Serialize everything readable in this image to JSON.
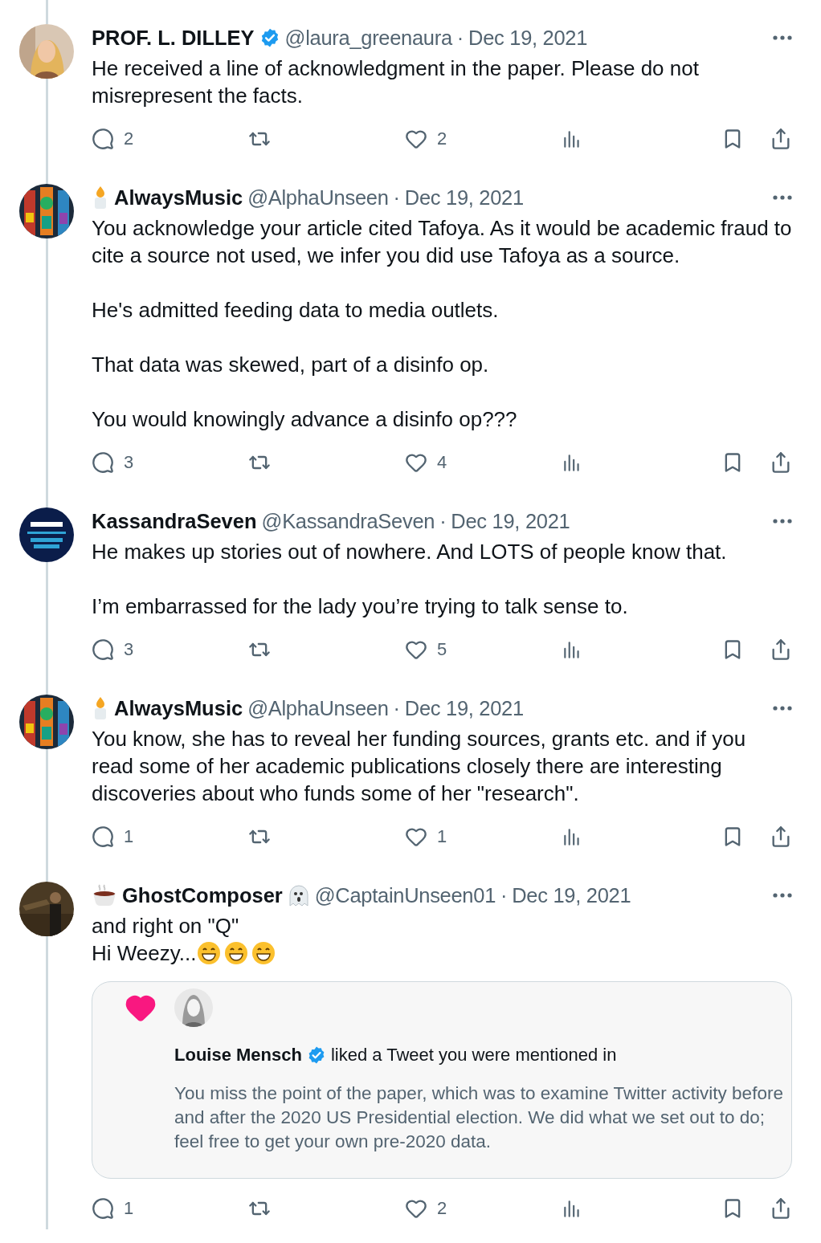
{
  "tweets": [
    {
      "avatar": {
        "kind": "person"
      },
      "author": {
        "name": "PROF. L. DILLEY",
        "verified": true,
        "handle": "@laura_greenaura",
        "separator": "·",
        "date": "Dec 19, 2021"
      },
      "paragraphs": [
        {
          "lines": [
            {
              "text": "He received a line of acknowledgment in the paper. Please do not misrepresent the facts."
            }
          ]
        }
      ],
      "stats": {
        "replies": "2",
        "likes": "2"
      }
    },
    {
      "avatar": {
        "kind": "stained-glass"
      },
      "author": {
        "emoji_before": {
          "kind": "candle"
        },
        "name": "AlwaysMusic",
        "verified": false,
        "handle": "@AlphaUnseen",
        "separator": "·",
        "date": "Dec 19, 2021"
      },
      "paragraphs": [
        {
          "lines": [
            {
              "text": "You acknowledge your article cited Tafoya. As it would be academic fraud to cite a source not used, we infer you did use Tafoya as a source."
            }
          ]
        },
        {
          "lines": [
            {
              "text": "He's admitted feeding data to media outlets."
            }
          ]
        },
        {
          "lines": [
            {
              "text": "That data was skewed, part of a disinfo op."
            }
          ]
        },
        {
          "lines": [
            {
              "text": "You would knowingly advance a disinfo op???"
            }
          ]
        }
      ],
      "stats": {
        "replies": "3",
        "likes": "4"
      }
    },
    {
      "avatar": {
        "kind": "badge"
      },
      "author": {
        "name": "KassandraSeven",
        "verified": false,
        "handle": "@KassandraSeven",
        "separator": "·",
        "date": "Dec 19, 2021"
      },
      "paragraphs": [
        {
          "lines": [
            {
              "text": "He makes up stories out of nowhere. And LOTS of people know that."
            }
          ]
        },
        {
          "lines": [
            {
              "text": "I’m embarrassed for the lady you’re trying to talk sense to."
            }
          ]
        }
      ],
      "stats": {
        "replies": "3",
        "likes": "5"
      }
    },
    {
      "avatar": {
        "kind": "stained-glass"
      },
      "author": {
        "emoji_before": {
          "kind": "candle"
        },
        "name": "AlwaysMusic",
        "verified": false,
        "handle": "@AlphaUnseen",
        "separator": "·",
        "date": "Dec 19, 2021"
      },
      "paragraphs": [
        {
          "lines": [
            {
              "text": "You know, she has to reveal her funding sources, grants etc. and if you read some of her academic publications closely there are interesting discoveries about who funds some of her \"research\"."
            }
          ]
        }
      ],
      "stats": {
        "replies": "1",
        "likes": "1"
      }
    },
    {
      "avatar": {
        "kind": "figure"
      },
      "author": {
        "emoji_before": {
          "kind": "coffee"
        },
        "name": "GhostComposer",
        "emoji_after": {
          "kind": "ghost"
        },
        "verified": false,
        "handle": "@CaptainUnseen01",
        "separator": "·",
        "date": "Dec 19, 2021"
      },
      "paragraphs": [
        {
          "lines": [
            {
              "text": "and right on \"Q\""
            },
            {
              "text": "Hi Weezy...",
              "emojis": [
                {
                  "kind": "grin"
                },
                {
                  "kind": "grin"
                },
                {
                  "kind": "grin"
                }
              ]
            }
          ]
        }
      ],
      "quote": {
        "name": "Louise Mensch",
        "verified": true,
        "action": "liked a Tweet you were mentioned in",
        "text": "You miss the point of the paper, which was to examine Twitter activity before and after the 2020 US Presidential election. We did what we set out to do; feel free to get your own pre-2020 data."
      },
      "stats": {
        "replies": "1",
        "likes": "2"
      }
    }
  ]
}
